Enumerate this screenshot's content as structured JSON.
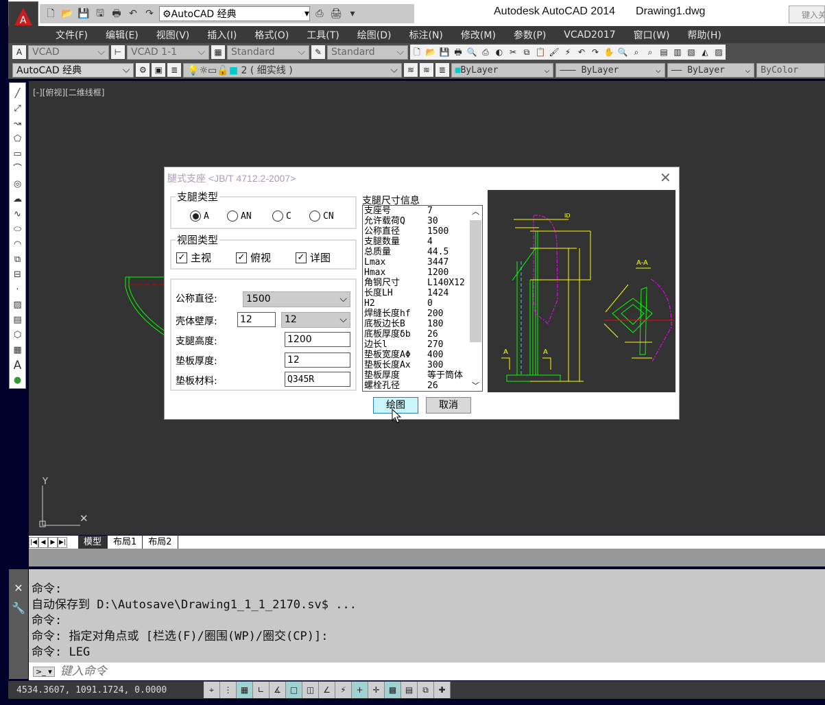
{
  "titlebar": {
    "app": "Autodesk AutoCAD 2014",
    "file": "Drawing1.dwg",
    "workspace": "AutoCAD 经典",
    "search_placeholder": "键入关"
  },
  "menu": [
    "文件(F)",
    "编辑(E)",
    "视图(V)",
    "插入(I)",
    "格式(O)",
    "工具(T)",
    "绘图(D)",
    "标注(N)",
    "修改(M)",
    "参数(P)",
    "VCAD2017",
    "窗口(W)",
    "帮助(H)"
  ],
  "toolbar1": {
    "text_style": "VCAD",
    "dim_style": "VCAD 1-1",
    "table_style": "Standard",
    "mleader_style": "Standard"
  },
  "toolbar2": {
    "workspace": "AutoCAD 经典",
    "layer": "2 ( 细实线 )",
    "color": "ByLayer",
    "linetype": "ByLayer",
    "lineweight": "ByLayer",
    "plotstyle": "ByColor"
  },
  "viewport_label": "[-][俯视][二维线框]",
  "tabs": [
    "模型",
    "布局1",
    "布局2"
  ],
  "command_history": [
    "命令:",
    "自动保存到 D:\\Autosave\\Drawing1_1_1_2170.sv$ ...",
    "命令:",
    "命令: 指定对角点或 [栏选(F)/圈围(WP)/圈交(CP)]:",
    "命令: LEG"
  ],
  "command_placeholder": "键入命令",
  "coords": "4534.3607, 1091.1724, 0.0000",
  "dialog": {
    "title": "腿式支座 <JB/T 4712.2-2007>",
    "leg_type_label": "支腿类型",
    "leg_types": [
      {
        "label": "A",
        "selected": true
      },
      {
        "label": "AN",
        "selected": false
      },
      {
        "label": "C",
        "selected": false
      },
      {
        "label": "CN",
        "selected": false
      }
    ],
    "view_type_label": "视图类型",
    "views": [
      {
        "label": "主视",
        "checked": true
      },
      {
        "label": "俯视",
        "checked": true
      },
      {
        "label": "详图",
        "checked": true
      }
    ],
    "fields": {
      "diameter_label": "公称直径:",
      "diameter": "1500",
      "shell_label": "壳体壁厚:",
      "shell_input": "12",
      "shell_select": "12",
      "height_label": "支腿高度:",
      "height": "1200",
      "pad_thk_label": "垫板厚度:",
      "pad_thk": "12",
      "pad_mat_label": "垫板材料:",
      "pad_mat": "Q345R"
    },
    "info_label": "支腿尺寸信息",
    "info": [
      [
        "支座号",
        "7"
      ],
      [
        "允许载荷Q",
        "30"
      ],
      [
        "公称直径",
        "1500"
      ],
      [
        "支腿数量",
        "4"
      ],
      [
        "总质量",
        "44.5"
      ],
      [
        "Lmax",
        "3447"
      ],
      [
        "Hmax",
        "1200"
      ],
      [
        "角钢尺寸",
        "L140X12"
      ],
      [
        "长度LH",
        "1424"
      ],
      [
        "H2",
        "0"
      ],
      [
        "焊缝长度hf",
        "200"
      ],
      [
        "底板边长B",
        "180"
      ],
      [
        "底板厚度δb",
        "26"
      ],
      [
        "边长l",
        "270"
      ],
      [
        "垫板宽度AΦ",
        "400"
      ],
      [
        "垫板长度Ax",
        "300"
      ],
      [
        "垫板厚度",
        "等于筒体"
      ],
      [
        "螺栓孔径",
        "26"
      ]
    ],
    "preview_section_label": "A-A",
    "draw_button": "绘图",
    "cancel_button": "取消"
  }
}
